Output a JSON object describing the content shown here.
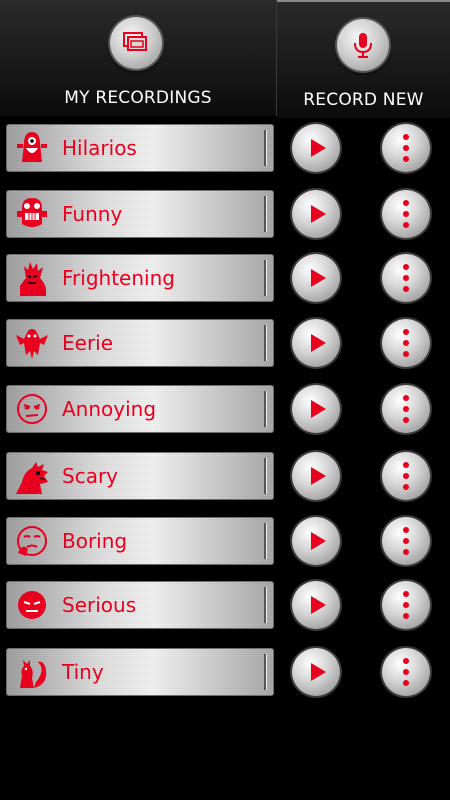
{
  "tabs": {
    "left_label": "MY RECORDINGS",
    "right_label": "RECORD NEW"
  },
  "colors": {
    "accent": "#e8001e",
    "background": "#000000"
  },
  "recordings": [
    {
      "label": "Hilarios",
      "icon": "laughing-monster-icon"
    },
    {
      "label": "Funny",
      "icon": "grinning-monster-icon"
    },
    {
      "label": "Frightening",
      "icon": "scary-face-icon"
    },
    {
      "label": "Eerie",
      "icon": "ghost-bat-icon"
    },
    {
      "label": "Annoying",
      "icon": "annoyed-face-icon"
    },
    {
      "label": "Scary",
      "icon": "rat-monster-icon"
    },
    {
      "label": "Boring",
      "icon": "bored-face-icon"
    },
    {
      "label": "Serious",
      "icon": "serious-face-icon"
    },
    {
      "label": "Tiny",
      "icon": "squirrel-icon"
    }
  ]
}
